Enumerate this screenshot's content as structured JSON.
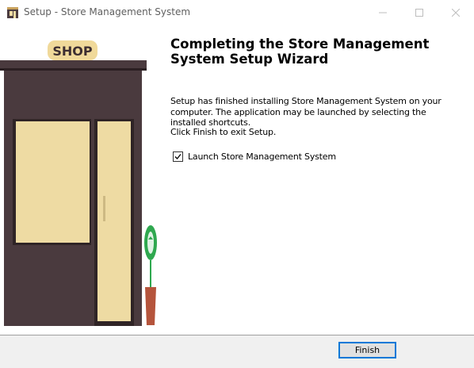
{
  "window": {
    "title": "Setup - Store Management System",
    "icon": "installer-icon",
    "controls": [
      "minimize-icon",
      "maximize-icon",
      "close-icon"
    ]
  },
  "side_panel": {
    "sign_text": "SHOP",
    "colors": {
      "building": "#4a3a3e",
      "doors": "#eedba3",
      "sign": "#f0d99a",
      "plant_leaves": "#2fa84f",
      "pot": "#b5543c"
    }
  },
  "content": {
    "heading": "Completing the Store Management System Setup Wizard",
    "paragraph1": "Setup has finished installing Store Management System on your computer. The application may be launched by selecting the installed shortcuts.",
    "paragraph2": "Click Finish to exit Setup.",
    "launch_checkbox": {
      "label": "Launch Store Management System",
      "checked": true
    }
  },
  "footer": {
    "finish_label": "Finish"
  }
}
